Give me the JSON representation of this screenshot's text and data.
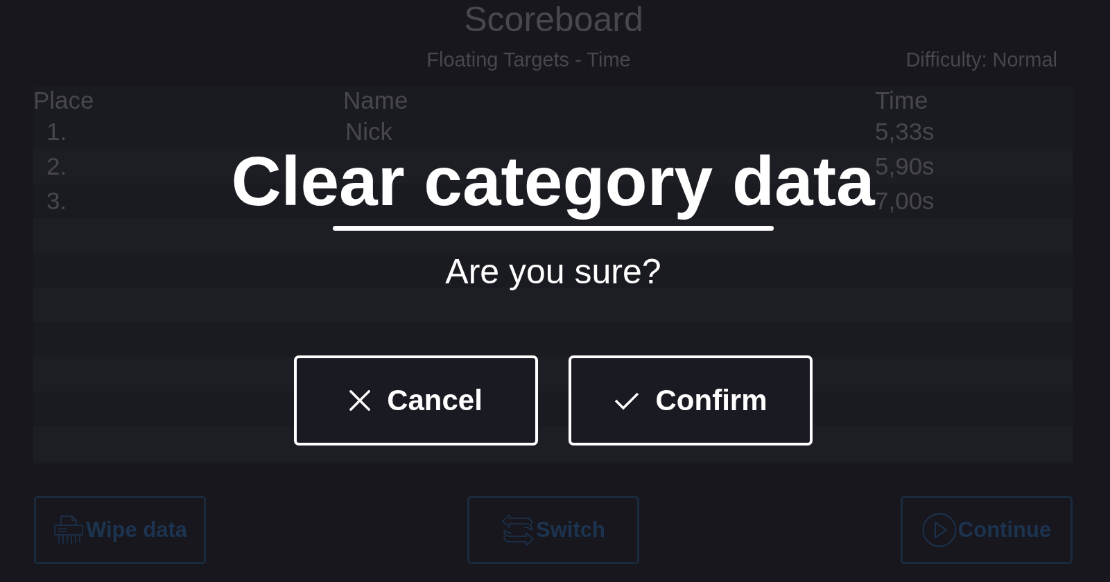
{
  "scoreboard": {
    "title": "Scoreboard",
    "mode": "Floating Targets - Time",
    "difficulty": "Difficulty: Normal",
    "columns": [
      "Place",
      "Name",
      "Time"
    ],
    "rows": [
      {
        "place": "1.",
        "name": "Nick",
        "time": "5,33s"
      },
      {
        "place": "2.",
        "time": "5,90s"
      },
      {
        "place": "3.",
        "time": "7,00s"
      }
    ],
    "buttons": [
      {
        "kind": "wipe",
        "label": "Wipe data"
      },
      {
        "kind": "switch",
        "label": "Switch"
      },
      {
        "kind": "continue",
        "label": "Continue"
      }
    ]
  },
  "dialog": {
    "title": "Clear category data",
    "message": "Are you sure?",
    "buttons": [
      {
        "kind": "cancel",
        "label": "Cancel"
      },
      {
        "kind": "confirm",
        "label": "Confirm"
      }
    ]
  }
}
